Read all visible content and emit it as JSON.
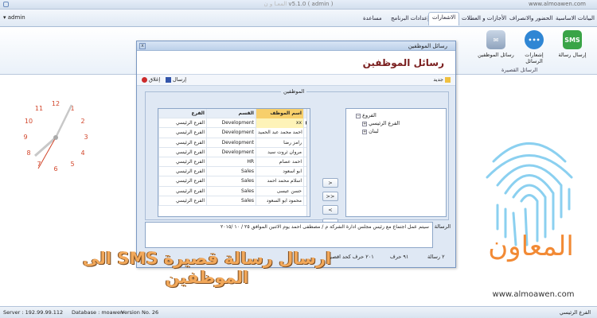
{
  "window": {
    "url": "www.almoawen.com",
    "title": "v5.1.0 ( admin )",
    "brand_blur": "المعـا و ن"
  },
  "tabs": [
    {
      "label": "البيانات الاساسية"
    },
    {
      "label": "الحضور والانصراف"
    },
    {
      "label": "الأجازات و العطلات"
    },
    {
      "label": "الاشعارات"
    },
    {
      "label": "إعدادات البرنامج"
    },
    {
      "label": "مساعدة"
    }
  ],
  "active_tab": "الاشعارات",
  "user": {
    "name": "admin"
  },
  "ribbon": {
    "buttons": [
      {
        "label": "إرسال رسالة",
        "icon": "sms-icon"
      },
      {
        "label": "إشعارات الرسائل",
        "icon": "messages-icon"
      },
      {
        "label": "رسائل الموظفين",
        "icon": "employee-messages-icon"
      }
    ],
    "group_label": "الرسائل القصيرة"
  },
  "dialog": {
    "title": "رسائل الموظفين",
    "header": "رسائل الموظفين",
    "toolbar": {
      "new": "جديد",
      "send": "إرسال",
      "close": "إغلاق"
    },
    "section_legend": "الموظفين",
    "grid": {
      "columns": [
        "اسم الموظف",
        "القسم",
        "الفرع"
      ],
      "rows": [
        {
          "name": "xx",
          "dept": "Development",
          "branch": "الفرع الرئيسي"
        },
        {
          "name": "احمد محمد عبد الحميد",
          "dept": "Development",
          "branch": "الفرع الرئيسي"
        },
        {
          "name": "رامز رضا",
          "dept": "Development",
          "branch": "الفرع الرئيسي"
        },
        {
          "name": "مروان ثروت سيد",
          "dept": "Development",
          "branch": "الفرع الرئيسي"
        },
        {
          "name": "احمد عصام",
          "dept": "HR",
          "branch": "الفرع الرئيسي"
        },
        {
          "name": "ابو اسعود",
          "dept": "Sales",
          "branch": "الفرع الرئيسي"
        },
        {
          "name": "اسلام محمد احمد",
          "dept": "Sales",
          "branch": "الفرع الرئيسي"
        },
        {
          "name": "حسن عيسى",
          "dept": "Sales",
          "branch": "الفرع الرئيسي"
        },
        {
          "name": "محمود ابو السعود",
          "dept": "Sales",
          "branch": "الفرع الرئيسي"
        }
      ]
    },
    "transfer_buttons": [
      ">",
      ">>",
      "<",
      "<<"
    ],
    "tree": {
      "root": "الفروع",
      "children": [
        "الفرع الرئيسي",
        "لبنان"
      ]
    },
    "message_label": "الرسالة",
    "message": "سيتم عمل اجتماع مع رئيس مجلس ادارة الشركة م / مصطفى احمد يوم الاثنين الموافق ٢٥ / ١٠ /٢٠١٥",
    "counts": {
      "messages": "٢ رسالة",
      "chars": "٩١ حرف",
      "max": "٢٠١ حرف كحد اقصى"
    }
  },
  "clock": {
    "numbers": [
      "12",
      "1",
      "2",
      "3",
      "4",
      "5",
      "6",
      "7",
      "8",
      "9",
      "10",
      "11"
    ]
  },
  "logo": {
    "text": "المعاون",
    "url": "www.almoawen.com"
  },
  "headline": "ارسال رسالة قصيرة SMS الى الموظفين",
  "status": {
    "server": "Server : 192.99.99.112",
    "database": "Database :   moawen",
    "version": "Version No.    26",
    "branch": "الفرع الرئيسي"
  }
}
